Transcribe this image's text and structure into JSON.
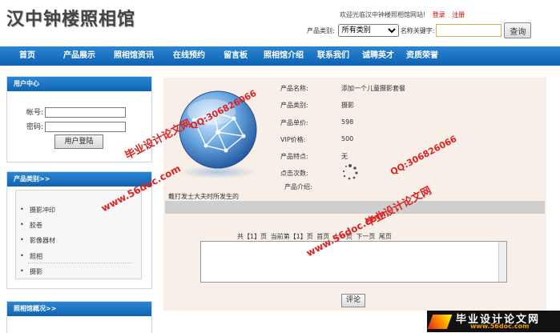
{
  "site": {
    "title": "汉中钟楼照相馆"
  },
  "header": {
    "welcome": "欢迎光临汉中钟楼照相馆网站!",
    "login_link": "登录",
    "register_link": "注册",
    "category_label": "产品类别:",
    "category_selected": "所有类别",
    "keyword_label": "名称关键字:",
    "keyword_value": "",
    "search_button": "查询"
  },
  "nav": {
    "items": [
      "首页",
      "产品展示",
      "照相馆资讯",
      "在线预约",
      "留言板",
      "照相馆介绍",
      "联系我们",
      "诚聘英才",
      "资质荣誉"
    ]
  },
  "user_center": {
    "title": "用户中心",
    "account_label": "帐号:",
    "password_label": "密码:",
    "login_button": "用户登陆"
  },
  "categories": {
    "title": "产品类别>>",
    "items": [
      "摄影冲印",
      "胶卷",
      "影像器材",
      "照相",
      "摄影"
    ]
  },
  "studio_overview": {
    "title": "照相馆概况>>"
  },
  "product": {
    "name_label": "产品名称:",
    "name_value": "添加一个儿童摄影套餐",
    "category_label": "产品类别:",
    "category_value": "摄影",
    "price_label": "产品单价:",
    "price_value": "598",
    "vip_label": "VIP价格:",
    "vip_value": "500",
    "feature_label": "产品特点:",
    "feature_value": "无",
    "clicks_label": "点击次数:",
    "intro_label": "产品介绍:",
    "description": "戴打发士大夫时所发生的"
  },
  "comments": {
    "bar_text": "",
    "pager": "共【1】页  当前第【1】页 首页  上一页  下一页  尾页",
    "comment_button": "评论"
  },
  "watermarks": {
    "qq": "QQ:306826066",
    "site_url": "www.56doc.com",
    "brand": "毕业设计论文网",
    "strip_title": "毕业设计论文网",
    "strip_url": "www.56doc.com"
  }
}
